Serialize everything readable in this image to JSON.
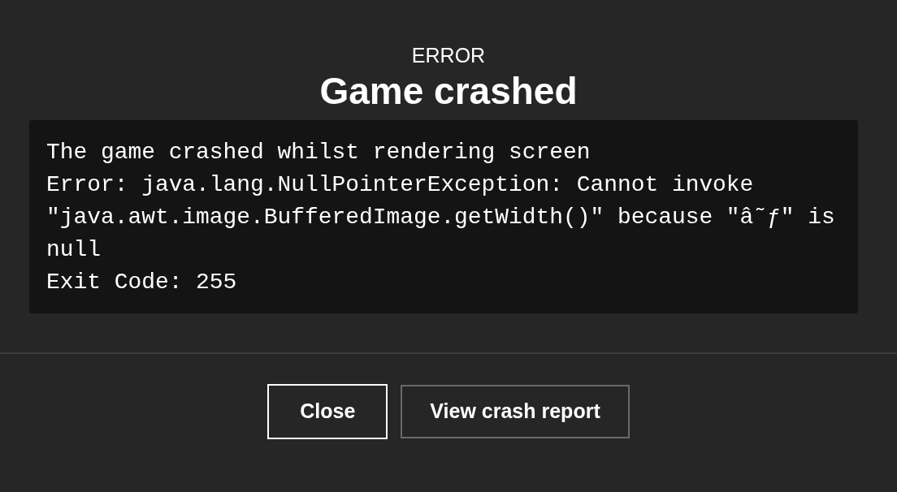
{
  "dialog": {
    "eyebrow": "ERROR",
    "title": "Game crashed",
    "log_lines": [
      "The game crashed whilst rendering screen",
      "Error: java.lang.NullPointerException: Cannot invoke \"java.awt.image.BufferedImage.getWidth()\" because \"â˜ƒ\" is null",
      "Exit Code: 255"
    ],
    "buttons": [
      {
        "label": "Close",
        "selected": true
      },
      {
        "label": "View crash report",
        "selected": false
      }
    ]
  }
}
